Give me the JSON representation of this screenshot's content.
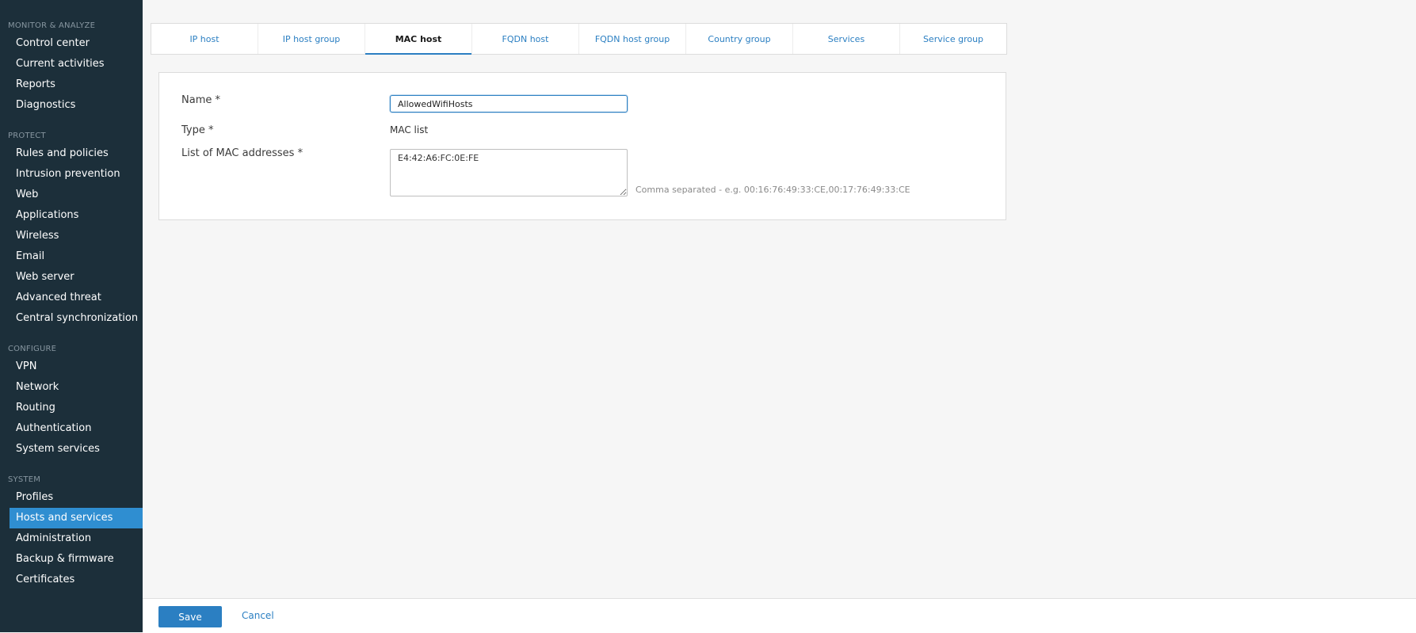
{
  "sidebar": {
    "sections": [
      {
        "title": "MONITOR & ANALYZE",
        "items": [
          "Control center",
          "Current activities",
          "Reports",
          "Diagnostics"
        ]
      },
      {
        "title": "PROTECT",
        "items": [
          "Rules and policies",
          "Intrusion prevention",
          "Web",
          "Applications",
          "Wireless",
          "Email",
          "Web server",
          "Advanced threat",
          "Central synchronization"
        ]
      },
      {
        "title": "CONFIGURE",
        "items": [
          "VPN",
          "Network",
          "Routing",
          "Authentication",
          "System services"
        ]
      },
      {
        "title": "SYSTEM",
        "items": [
          "Profiles",
          "Hosts and services",
          "Administration",
          "Backup & firmware",
          "Certificates"
        ]
      }
    ],
    "active_item": "Hosts and services"
  },
  "tabs": [
    "IP host",
    "IP host group",
    "MAC host",
    "FQDN host",
    "FQDN host group",
    "Country group",
    "Services",
    "Service group"
  ],
  "active_tab": "MAC host",
  "form": {
    "name_label": "Name *",
    "name_value": "AllowedWifiHosts",
    "type_label": "Type *",
    "type_value": "MAC list",
    "mac_label": "List of MAC addresses *",
    "mac_value": "E4:42:A6:FC:0E:FE",
    "mac_hint": "Comma separated - e.g. 00:16:76:49:33:CE,00:17:76:49:33:CE"
  },
  "footer": {
    "save_label": "Save",
    "cancel_label": "Cancel"
  },
  "colors": {
    "sidebar_bg": "#1c2f3a",
    "accent": "#2b7fc2",
    "active_nav": "#2f8ed1"
  }
}
